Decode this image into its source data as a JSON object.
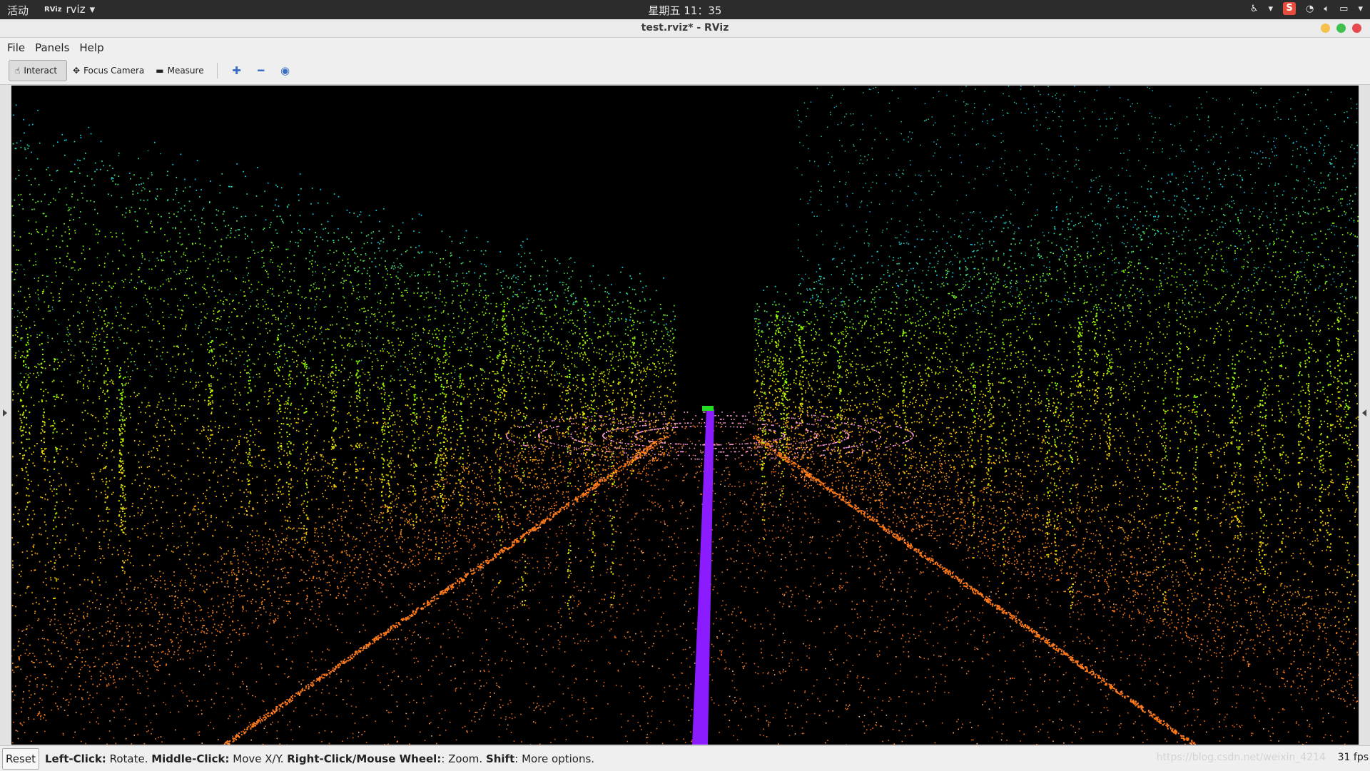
{
  "system": {
    "activities": "活动",
    "app_icon": "RViz",
    "app_name": "rviz",
    "clock": "星期五 11：35"
  },
  "window": {
    "title": "test.rviz* - RViz",
    "buttons": {
      "minimize_color": "#f5c04c",
      "maximize_color": "#3fc24f",
      "close_color": "#e5484d"
    }
  },
  "menu": {
    "file": "File",
    "panels": "Panels",
    "help": "Help"
  },
  "toolbar": {
    "interact": "Interact",
    "focus_camera": "Focus Camera",
    "measure": "Measure",
    "add_icon": "plus-icon",
    "remove_icon": "minus-icon",
    "camera_icon": "eye-icon"
  },
  "viewport": {
    "content": "3D point cloud of a forest road",
    "colors": {
      "far": "#00c8ff",
      "trees": "#7fff00",
      "mid": "#ffd700",
      "ground": "#ff7a1a",
      "path": "#8a1cff"
    }
  },
  "status": {
    "reset_label": "Reset",
    "hint": {
      "left_click_key": "Left-Click:",
      "left_click_action": " Rotate. ",
      "middle_click_key": "Middle-Click:",
      "middle_click_action": " Move X/Y. ",
      "right_click_key": "Right-Click/Mouse Wheel:",
      "right_click_action": ": Zoom. ",
      "shift_key": "Shift",
      "shift_action": ": More options."
    },
    "watermark": "https://blog.csdn.net/weixin_4214",
    "fps": "31 fps"
  }
}
